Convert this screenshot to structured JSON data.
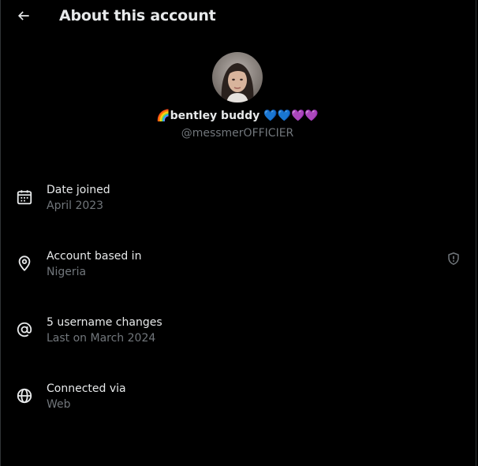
{
  "header": {
    "title": "About this account",
    "back_icon": "arrow-left-icon"
  },
  "profile": {
    "display_name": "🌈bentley buddy 💙💙💜💜",
    "handle": "@messmerOFFICIER"
  },
  "details": [
    {
      "icon": "calendar-icon",
      "label": "Date joined",
      "value": "April 2023"
    },
    {
      "icon": "location-pin-icon",
      "label": "Account based in",
      "value": "Nigeria",
      "action_icon": "shield-alert-icon"
    },
    {
      "icon": "at-sign-icon",
      "label": "5 username changes",
      "value": "Last on March 2024"
    },
    {
      "icon": "globe-icon",
      "label": "Connected via",
      "value": "Web"
    }
  ],
  "colors": {
    "background": "#000000",
    "primary_text": "#e7e9ea",
    "secondary_text": "#71767b",
    "border": "#2f3336"
  }
}
